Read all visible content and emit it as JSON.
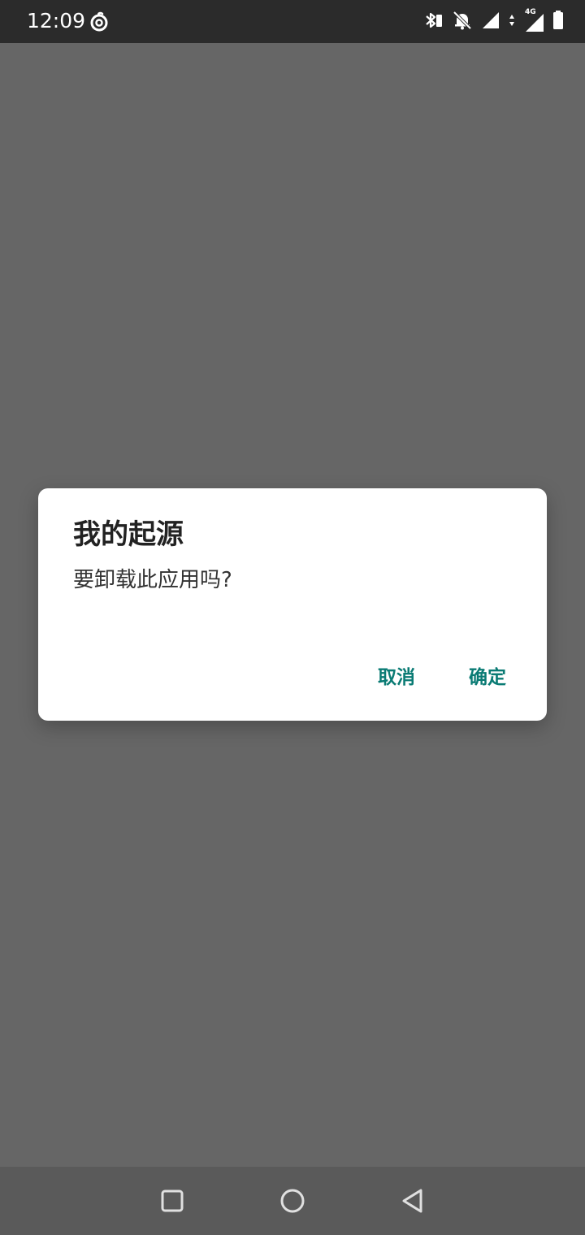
{
  "status_bar": {
    "time": "12:09",
    "network_label": "4G",
    "icons": [
      "netease-cloud-music-icon",
      "bluetooth-icon",
      "notifications-off-icon",
      "signal-icon",
      "data-arrows-icon",
      "signal-4g-icon",
      "battery-icon"
    ]
  },
  "dialog": {
    "title": "我的起源",
    "message": "要卸载此应用吗?",
    "cancel_label": "取消",
    "ok_label": "确定",
    "accent_color": "#0a7b74"
  },
  "nav_bar": {
    "icons": [
      "recents-icon",
      "home-icon",
      "back-icon"
    ]
  }
}
